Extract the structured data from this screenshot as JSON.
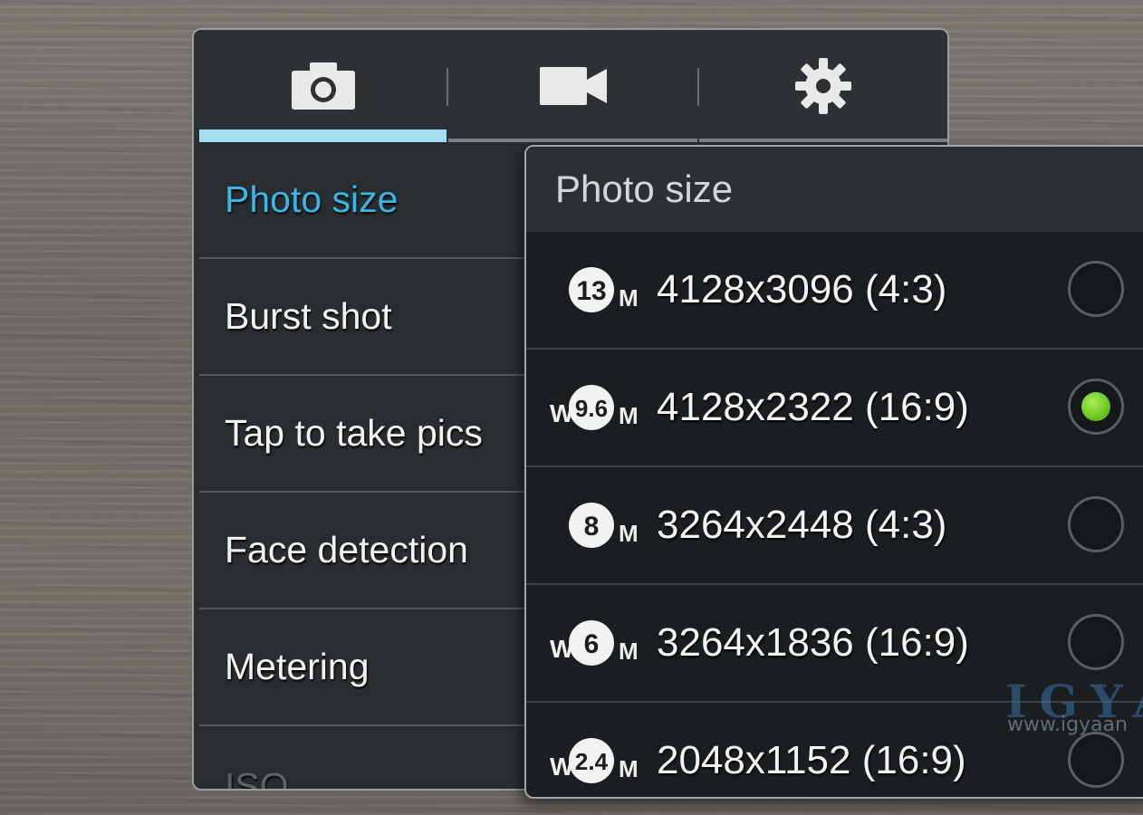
{
  "tabs": [
    {
      "icon": "camera-icon",
      "active": true
    },
    {
      "icon": "video-camera-icon",
      "active": false
    },
    {
      "icon": "gear-icon",
      "active": false
    }
  ],
  "menu": {
    "items": [
      {
        "label": "Photo size",
        "active": true
      },
      {
        "label": "Burst shot"
      },
      {
        "label": "Tap to take pics"
      },
      {
        "label": "Face detection"
      },
      {
        "label": "Metering"
      },
      {
        "label": "ISO"
      }
    ]
  },
  "popup": {
    "title": "Photo size",
    "options": [
      {
        "wide": "",
        "mp": "13",
        "suffix": "M",
        "label": "4128x3096 (4:3)",
        "selected": false
      },
      {
        "wide": "W",
        "mp": "9.6",
        "suffix": "M",
        "label": "4128x2322 (16:9)",
        "selected": true
      },
      {
        "wide": "",
        "mp": "8",
        "suffix": "M",
        "label": "3264x2448 (4:3)",
        "selected": false
      },
      {
        "wide": "W",
        "mp": "6",
        "suffix": "M",
        "label": "3264x1836 (16:9)",
        "selected": false
      },
      {
        "wide": "W",
        "mp": "2.4",
        "suffix": "M",
        "label": "2048x1152 (16:9)",
        "selected": false
      }
    ]
  },
  "watermark": {
    "text": "IGYA",
    "sub": "www.igyaan"
  },
  "colors": {
    "accent": "#38b6e6",
    "tab_indicator": "#a6dcf1",
    "selected_radio": "#7ad632"
  }
}
